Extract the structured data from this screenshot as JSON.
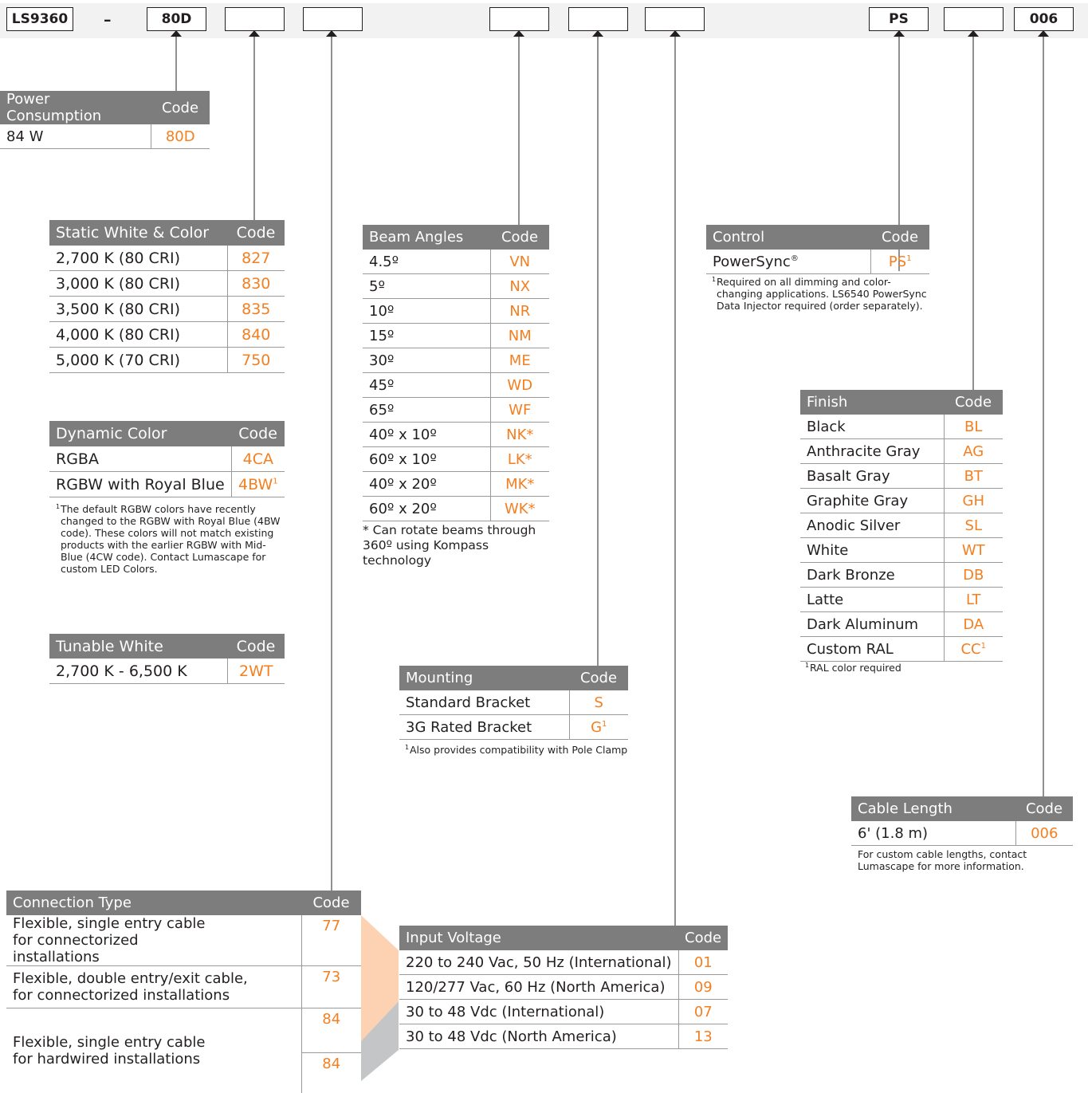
{
  "header": {
    "boxes": [
      "LS9360",
      "80D",
      "",
      "",
      "",
      "",
      "",
      "PS",
      "",
      "006"
    ],
    "dash": "–"
  },
  "power": {
    "title": "Power Consumption",
    "code_label": "Code",
    "rows": [
      {
        "label": "84 W",
        "code": "80D"
      }
    ]
  },
  "static": {
    "title": "Static White & Color",
    "code_label": "Code",
    "rows": [
      {
        "label": "2,700 K (80 CRI)",
        "code": "827"
      },
      {
        "label": "3,000 K (80 CRI)",
        "code": "830"
      },
      {
        "label": "3,500 K (80 CRI)",
        "code": "835"
      },
      {
        "label": "4,000 K (80 CRI)",
        "code": "840"
      },
      {
        "label": "5,000 K (70 CRI)",
        "code": "750"
      }
    ]
  },
  "dynamic": {
    "title": "Dynamic Color",
    "code_label": "Code",
    "rows": [
      {
        "label": "RGBA",
        "code": "4CA",
        "sup": ""
      },
      {
        "label": "RGBW with Royal Blue",
        "code": "4BW",
        "sup": "1"
      }
    ],
    "note_sup": "1",
    "note": "The default RGBW colors have recently changed to the RGBW with Royal Blue (4BW code). These colors will not match existing products with the earlier RGBW with Mid-Blue (4CW code). Contact Lumascape for custom LED Colors."
  },
  "tunable": {
    "title": "Tunable White",
    "code_label": "Code",
    "rows": [
      {
        "label": "2,700 K - 6,500 K",
        "code": "2WT"
      }
    ]
  },
  "beam": {
    "title": "Beam Angles",
    "code_label": "Code",
    "rows": [
      {
        "label": "4.5º",
        "code": "VN"
      },
      {
        "label": "5º",
        "code": "NX"
      },
      {
        "label": "10º",
        "code": "NR"
      },
      {
        "label": "15º",
        "code": "NM"
      },
      {
        "label": "30º",
        "code": "ME"
      },
      {
        "label": "45º",
        "code": "WD"
      },
      {
        "label": "65º",
        "code": "WF"
      },
      {
        "label": "40º x 10º",
        "code": "NK*"
      },
      {
        "label": "60º x 10º",
        "code": "LK*"
      },
      {
        "label": "40º x 20º",
        "code": "MK*"
      },
      {
        "label": "60º x 20º",
        "code": "WK*"
      }
    ],
    "note": "* Can rotate beams through 360º using Kompass technology"
  },
  "control": {
    "title": "Control",
    "code_label": "Code",
    "rows": [
      {
        "label": "PowerSync",
        "label_sup": "®",
        "code": "PS",
        "sup": "1"
      }
    ],
    "note_sup": "1",
    "note": "Required on all dimming and color-changing applications. LS6540 PowerSync Data Injector required (order separately)."
  },
  "finish": {
    "title": "Finish",
    "code_label": "Code",
    "rows": [
      {
        "label": "Black",
        "code": "BL",
        "sup": ""
      },
      {
        "label": "Anthracite Gray",
        "code": "AG",
        "sup": ""
      },
      {
        "label": "Basalt Gray",
        "code": "BT",
        "sup": ""
      },
      {
        "label": "Graphite Gray",
        "code": "GH",
        "sup": ""
      },
      {
        "label": "Anodic Silver",
        "code": "SL",
        "sup": ""
      },
      {
        "label": "White",
        "code": "WT",
        "sup": ""
      },
      {
        "label": "Dark Bronze",
        "code": "DB",
        "sup": ""
      },
      {
        "label": "Latte",
        "code": "LT",
        "sup": ""
      },
      {
        "label": "Dark Aluminum",
        "code": "DA",
        "sup": ""
      },
      {
        "label": "Custom RAL",
        "code": "CC",
        "sup": "1"
      }
    ],
    "note_sup": "1",
    "note": "RAL color required"
  },
  "mounting": {
    "title": "Mounting",
    "code_label": "Code",
    "rows": [
      {
        "label": "Standard Bracket",
        "code": "S",
        "sup": ""
      },
      {
        "label": "3G Rated Bracket",
        "code": "G",
        "sup": "1"
      }
    ],
    "note_sup": "1",
    "note": "Also provides compatibility with Pole Clamp"
  },
  "cable": {
    "title": "Cable Length",
    "code_label": "Code",
    "rows": [
      {
        "label": "6' (1.8 m)",
        "code": "006"
      }
    ],
    "note": "For custom cable lengths, contact Lumascape for more information."
  },
  "connection": {
    "title": "Connection Type",
    "code_label": "Code",
    "rows": [
      {
        "label": "Flexible, single entry cable for connectorized installations",
        "code": "77"
      },
      {
        "label": "Flexible, double entry/exit cable, for connectorized installations",
        "code": "73"
      },
      {
        "label": "Flexible, single entry cable for hardwired installations",
        "code": "84",
        "code2": "84"
      }
    ]
  },
  "voltage": {
    "title": "Input Voltage",
    "code_label": "Code",
    "rows": [
      {
        "label": "220 to 240 Vac, 50 Hz (International)",
        "code": "01"
      },
      {
        "label": "120/277 Vac, 60 Hz (North America)",
        "code": "09"
      },
      {
        "label": "30 to 48 Vdc (International)",
        "code": "07"
      },
      {
        "label": "30 to 48 Vdc (North America)",
        "code": "13"
      }
    ]
  },
  "colors": {
    "accent": "#f47f20",
    "header_gray": "#7d7d7e",
    "peach": "#fdd2b3",
    "wedge_gray": "#c4c5c6"
  }
}
